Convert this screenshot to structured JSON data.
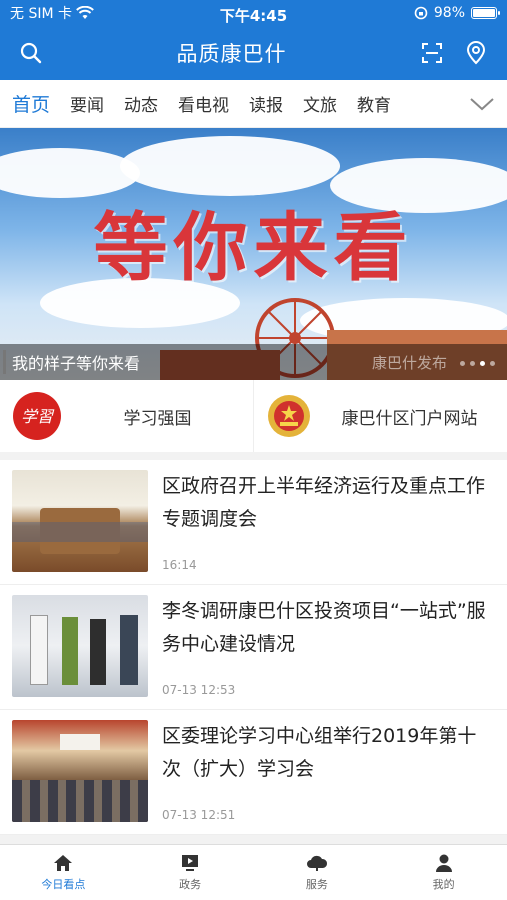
{
  "status": {
    "carrier": "无 SIM 卡",
    "time": "下午4:45",
    "battery": "98%",
    "battery_level": 0.98
  },
  "header": {
    "title": "品质康巴什"
  },
  "tabs": [
    {
      "label": "首页",
      "active": true
    },
    {
      "label": "要闻"
    },
    {
      "label": "动态"
    },
    {
      "label": "看电视"
    },
    {
      "label": "读报"
    },
    {
      "label": "文旅"
    },
    {
      "label": "教育"
    }
  ],
  "banner": {
    "headline": "等你来看",
    "caption": "我的样子等你来看",
    "watermark": "康巴什发布"
  },
  "quick_links": [
    {
      "label": "学习强国",
      "logo_text": "学習",
      "icon": "xuexi-logo-icon"
    },
    {
      "label": "康巴什区门户网站",
      "icon": "national-emblem-icon"
    }
  ],
  "news": [
    {
      "title": "区政府召开上半年经济运行及重点工作专题调度会",
      "time": "16:14"
    },
    {
      "title": "李冬调研康巴什区投资项目“一站式”服务中心建设情况",
      "time": "07-13 12:53"
    },
    {
      "title": "区委理论学习中心组举行2019年第十次（扩大）学习会",
      "time": "07-13 12:51"
    }
  ],
  "bottom_nav": [
    {
      "label": "今日看点",
      "icon": "home-icon",
      "active": true
    },
    {
      "label": "政务",
      "icon": "tv-icon"
    },
    {
      "label": "服务",
      "icon": "cloud-icon"
    },
    {
      "label": "我的",
      "icon": "user-icon"
    }
  ],
  "colors": {
    "primary": "#1f7ad6",
    "headline_red": "#d9363a"
  }
}
